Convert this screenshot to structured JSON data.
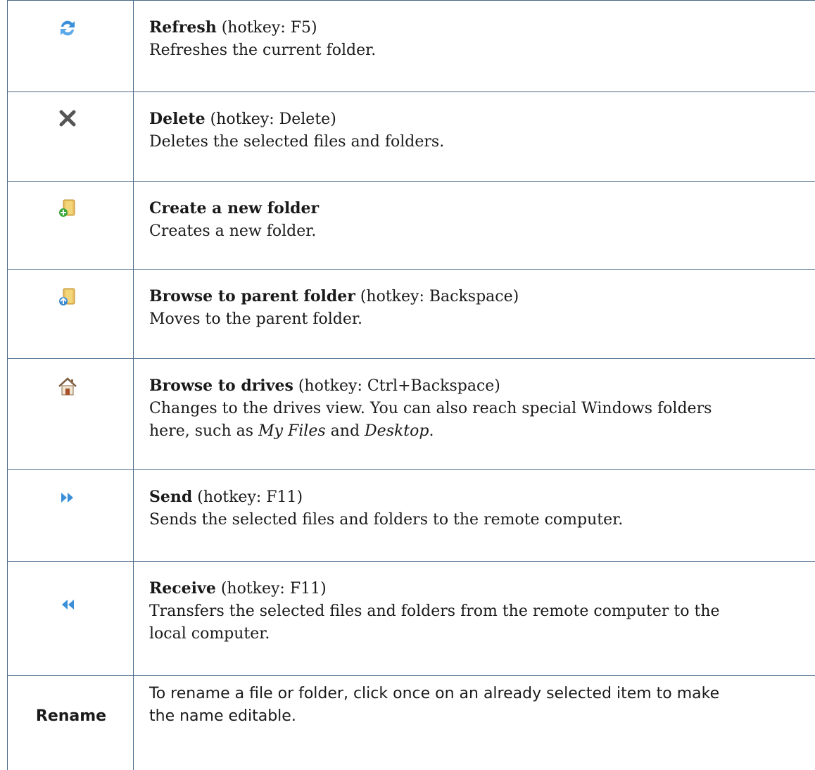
{
  "rows": [
    {
      "title": "Refresh",
      "hotkey": "(hotkey: F5)",
      "desc": "Refreshes the current folder.",
      "icon": "refresh-icon"
    },
    {
      "title": "Delete",
      "hotkey": "(hotkey: Delete)",
      "desc": "Deletes the selected files and folders.",
      "icon": "delete-icon"
    },
    {
      "title": "Create a new folder",
      "hotkey": "",
      "desc": "Creates a new folder.",
      "icon": "new-folder-icon"
    },
    {
      "title": "Browse to parent folder",
      "hotkey": "(hotkey: Backspace)",
      "desc": "Moves to the parent folder.",
      "icon": "parent-folder-icon"
    },
    {
      "title": "Browse to drives",
      "hotkey": "(hotkey: Ctrl+Backspace)",
      "desc_line1": "Changes to the drives view. You can also reach special Windows folders",
      "desc_line2_pre": "here, such as ",
      "desc_em1": "My Files",
      "desc_mid": " and ",
      "desc_em2": "Desktop",
      "desc_end": ".",
      "icon": "home-icon"
    },
    {
      "title": "Send",
      "hotkey": "(hotkey: F11)",
      "desc": "Sends the selected files and folders to the remote computer.",
      "icon": "send-icon"
    },
    {
      "title": "Receive",
      "hotkey": "(hotkey: F11)",
      "desc_line1": "Transfers the selected files and folders from the remote computer to the",
      "desc_line2": "local computer.",
      "icon": "receive-icon"
    },
    {
      "label": "Rename",
      "desc_line1": "To rename a file or folder, click once on an already selected item to make",
      "desc_line2": "the name editable."
    }
  ],
  "colors": {
    "border": "#4a6a8a"
  }
}
